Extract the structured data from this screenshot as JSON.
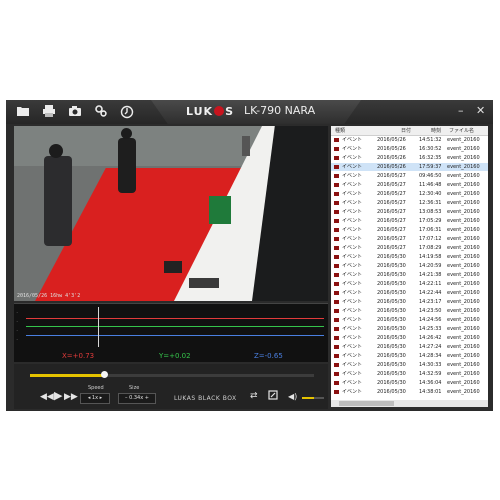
{
  "window": {
    "logo_left": "LUK",
    "logo_right": "S",
    "model": "LK-790 NARA"
  },
  "toolbar": {
    "icons": [
      "folder-icon",
      "print-icon",
      "camera-icon",
      "settings-icon",
      "clock-icon"
    ],
    "window_buttons": {
      "minimize": "–",
      "close": "✕"
    }
  },
  "video": {
    "timestamp": "2016/05/26 16hw 4'3'2"
  },
  "graph": {
    "x_label": "X=+0.73",
    "y_label": "Y=+0.02",
    "z_label": "Z=-0.65",
    "colors": {
      "x": "#e23b3b",
      "y": "#35c44b",
      "z": "#4a7fe0"
    },
    "cursor_position": 0.24
  },
  "controls": {
    "speed_label": "Speed",
    "speed_value": "1x",
    "size_label": "Size",
    "size_value": "0.34x",
    "brand": "LUKAS BLACK BOX",
    "seek_progress": 0.26,
    "volume_level": 0.55
  },
  "event_list": {
    "headers": {
      "type": "種類",
      "date": "日付",
      "time": "時刻",
      "file": "ファイル名"
    },
    "rows": [
      {
        "type": "イベント",
        "date": "2016/05/26",
        "time": "14:51:32",
        "file": "event_20160"
      },
      {
        "type": "イベント",
        "date": "2016/05/26",
        "time": "16:30:52",
        "file": "event_20160"
      },
      {
        "type": "イベント",
        "date": "2016/05/26",
        "time": "16:32:35",
        "file": "event_20160"
      },
      {
        "type": "イベント",
        "date": "2016/05/26",
        "time": "17:59:37",
        "file": "event_20160"
      },
      {
        "type": "イベント",
        "date": "2016/05/27",
        "time": "09:46:50",
        "file": "event_20160"
      },
      {
        "type": "イベント",
        "date": "2016/05/27",
        "time": "11:46:48",
        "file": "event_20160"
      },
      {
        "type": "イベント",
        "date": "2016/05/27",
        "time": "12:30:40",
        "file": "event_20160"
      },
      {
        "type": "イベント",
        "date": "2016/05/27",
        "time": "12:36:31",
        "file": "event_20160"
      },
      {
        "type": "イベント",
        "date": "2016/05/27",
        "time": "13:08:53",
        "file": "event_20160"
      },
      {
        "type": "イベント",
        "date": "2016/05/27",
        "time": "17:05:29",
        "file": "event_20160"
      },
      {
        "type": "イベント",
        "date": "2016/05/27",
        "time": "17:06:31",
        "file": "event_20160"
      },
      {
        "type": "イベント",
        "date": "2016/05/27",
        "time": "17:07:12",
        "file": "event_20160"
      },
      {
        "type": "イベント",
        "date": "2016/05/27",
        "time": "17:08:29",
        "file": "event_20160"
      },
      {
        "type": "イベント",
        "date": "2016/05/30",
        "time": "14:19:58",
        "file": "event_20160"
      },
      {
        "type": "イベント",
        "date": "2016/05/30",
        "time": "14:20:59",
        "file": "event_20160"
      },
      {
        "type": "イベント",
        "date": "2016/05/30",
        "time": "14:21:38",
        "file": "event_20160"
      },
      {
        "type": "イベント",
        "date": "2016/05/30",
        "time": "14:22:11",
        "file": "event_20160"
      },
      {
        "type": "イベント",
        "date": "2016/05/30",
        "time": "14:22:44",
        "file": "event_20160"
      },
      {
        "type": "イベント",
        "date": "2016/05/30",
        "time": "14:23:17",
        "file": "event_20160"
      },
      {
        "type": "イベント",
        "date": "2016/05/30",
        "time": "14:23:50",
        "file": "event_20160"
      },
      {
        "type": "イベント",
        "date": "2016/05/30",
        "time": "14:24:56",
        "file": "event_20160"
      },
      {
        "type": "イベント",
        "date": "2016/05/30",
        "time": "14:25:33",
        "file": "event_20160"
      },
      {
        "type": "イベント",
        "date": "2016/05/30",
        "time": "14:26:42",
        "file": "event_20160"
      },
      {
        "type": "イベント",
        "date": "2016/05/30",
        "time": "14:27:24",
        "file": "event_20160"
      },
      {
        "type": "イベント",
        "date": "2016/05/30",
        "time": "14:28:34",
        "file": "event_20160"
      },
      {
        "type": "イベント",
        "date": "2016/05/30",
        "time": "14:30:33",
        "file": "event_20160"
      },
      {
        "type": "イベント",
        "date": "2016/05/30",
        "time": "14:32:59",
        "file": "event_20160"
      },
      {
        "type": "イベント",
        "date": "2016/05/30",
        "time": "14:36:04",
        "file": "event_20160"
      },
      {
        "type": "イベント",
        "date": "2016/05/30",
        "time": "14:38:01",
        "file": "event_20160"
      }
    ]
  }
}
